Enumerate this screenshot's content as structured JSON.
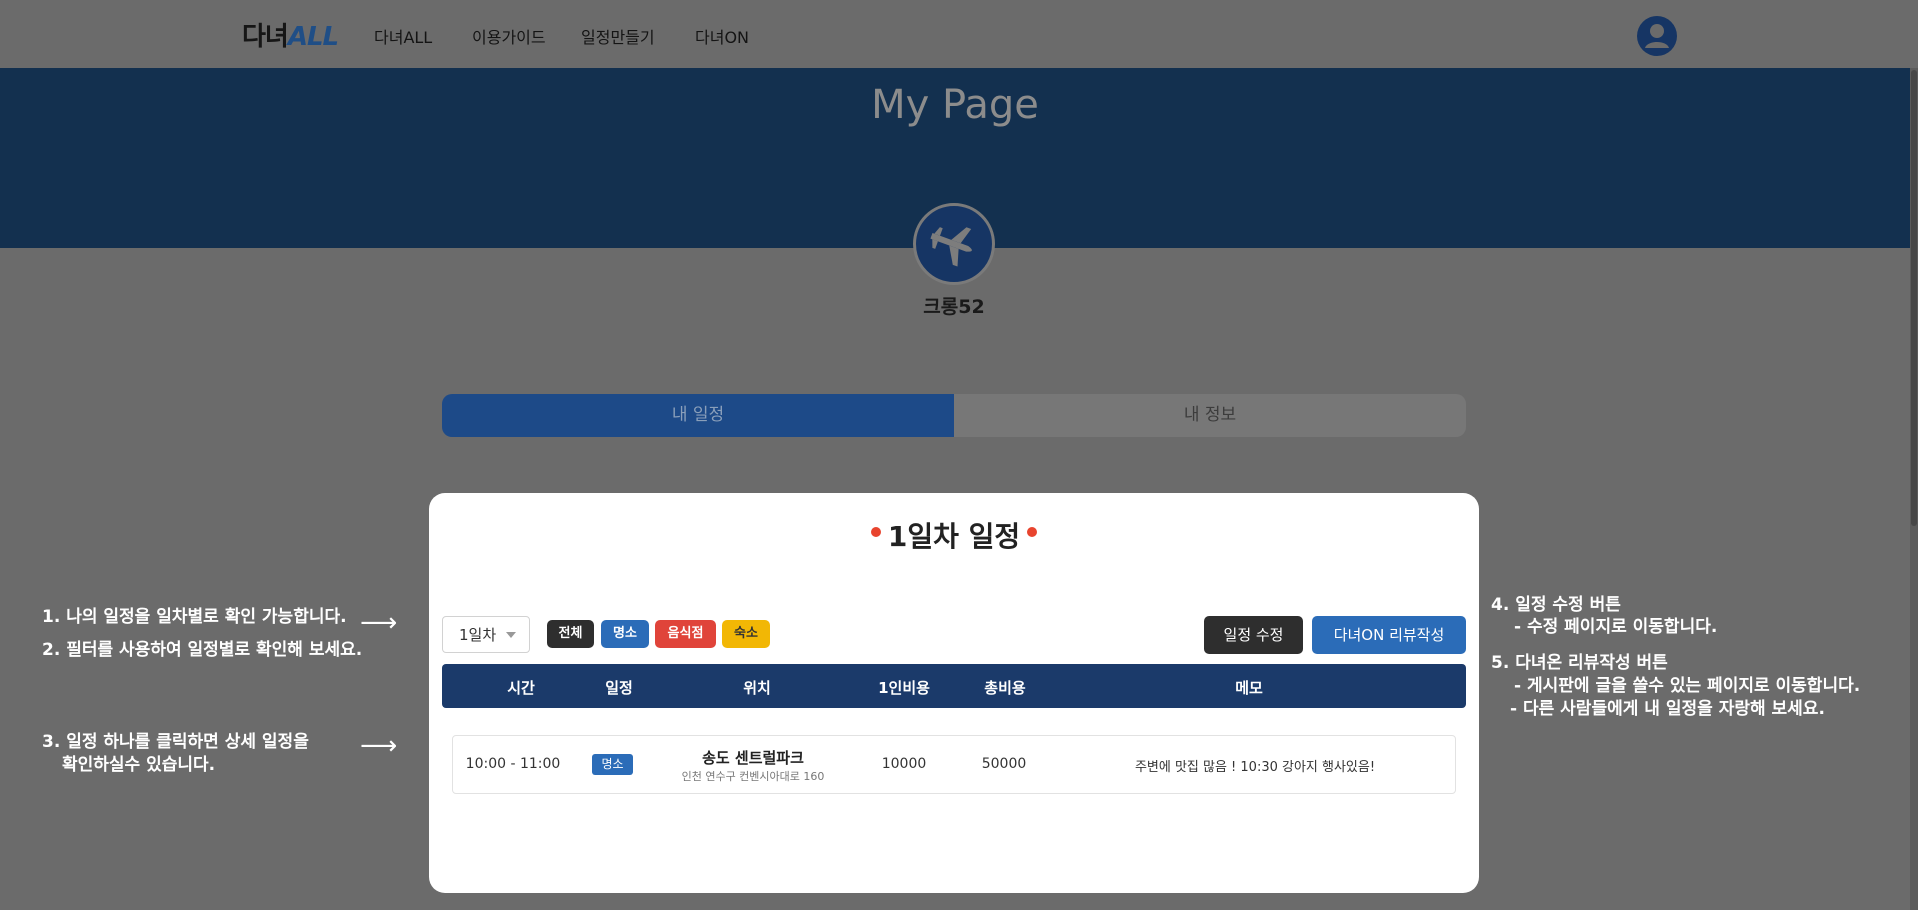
{
  "header": {
    "logo_main": "다녀",
    "logo_accent": "ALL",
    "nav": [
      "다녀ALL",
      "이용가이드",
      "일정만들기",
      "다녀ON"
    ]
  },
  "hero": {
    "title": "My Page"
  },
  "profile": {
    "name": "크롱52"
  },
  "tabs": [
    "내 일정",
    "내 정보"
  ],
  "notes_left": {
    "n1": "1. 나의 일정을 일차별로 확인 가능합니다.",
    "n2": "2. 필터를 사용하여 일정별로 확인해 보세요.",
    "n3a": "3. 일정 하나를 클릭하면 상세 일정을",
    "n3b": "확인하실수 있습니다."
  },
  "notes_right": {
    "n4": "4. 일정 수정 버튼",
    "n4a": "- 수정 페이지로 이동합니다.",
    "n5": "5. 다녀온 리뷰작성 버튼",
    "n5a": "- 게시판에 글을 쓸수 있는 페이지로 이동합니다.",
    "n5b": "-  다른 사람들에게 내 일정을 자랑해 보세요."
  },
  "arrow_glyph": "⟶",
  "schedule": {
    "title": "1일차 일정",
    "day_select": "1일차",
    "filters": [
      {
        "label": "전체",
        "color": "#2e2e2e",
        "text_color": "#ffffff"
      },
      {
        "label": "명소",
        "color": "#2b6cb8",
        "text_color": "#ffffff"
      },
      {
        "label": "음식점",
        "color": "#e0443a",
        "text_color": "#ffffff"
      },
      {
        "label": "숙소",
        "color": "#f2b705",
        "text_color": "#333333"
      }
    ],
    "edit_button": "일정 수정",
    "review_button": "다녀ON 리뷰작성",
    "columns": [
      "시간",
      "일정",
      "위치",
      "1인비용",
      "총비용",
      "메모"
    ],
    "rows": [
      {
        "time": "10:00 - 11:00",
        "category": "명소",
        "place": "송도 센트럴파크",
        "address": "인천 연수구 컨벤시아대로 160",
        "per_person": "10000",
        "total": "50000",
        "memo": "주변에 맛집 많음 ! 10:30 강아지 행사있음!"
      }
    ]
  },
  "colors": {
    "accent": "#2b6cb8",
    "navy": "#1b3a6a",
    "dot": "#e8442e",
    "overlay": "#6b6b6b"
  }
}
